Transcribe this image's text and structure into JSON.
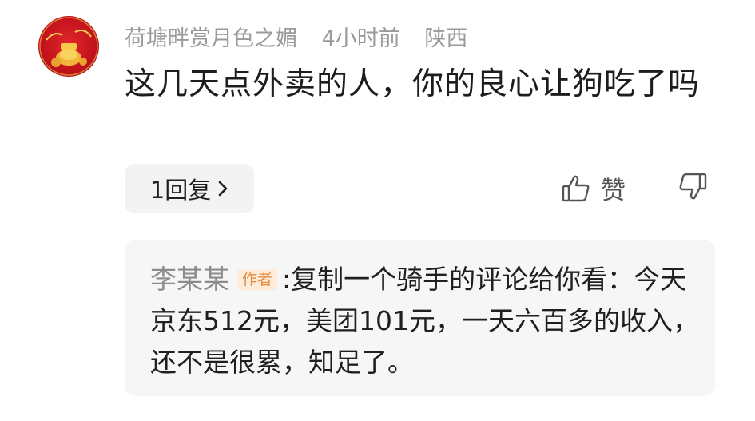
{
  "comment": {
    "username": "荷塘畔赏月色之媚",
    "time": "4小时前",
    "location": "陕西",
    "text": "这几天点外卖的人，你的良心让狗吃了吗",
    "reply_button_label": "1回复",
    "like_label": "赞"
  },
  "reply": {
    "author": "李某某",
    "badge": "作者",
    "text": ":复制一个骑手的评论给你看：今天京东512元，美团101元，一天六百多的收入，还不是很累，知足了。"
  },
  "colors": {
    "meta_text": "#9a9a9a",
    "reply_bg": "#f6f6f6",
    "badge_bg": "#fdecd9",
    "badge_text": "#e48a3b"
  },
  "icons": {
    "avatar": "red-new-year-avatar",
    "reply_chevron": "chevron-right-icon",
    "like": "thumbs-up-icon",
    "dislike": "thumbs-down-icon"
  }
}
